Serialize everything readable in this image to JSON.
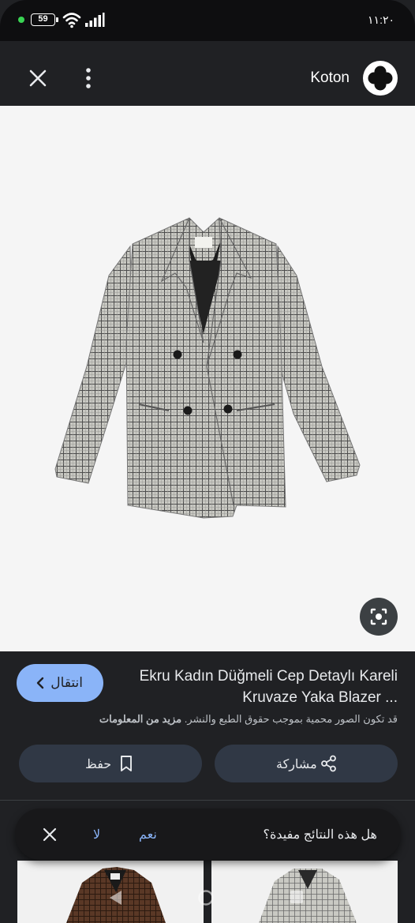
{
  "status_bar": {
    "battery": "59",
    "time": "١١:٢٠",
    "icons": [
      "notification-dot-icon",
      "battery-icon",
      "wifi-icon",
      "signal-icon"
    ]
  },
  "top_bar": {
    "close_icon": "close-icon",
    "more_icon": "more-vert-icon",
    "brand": "Koton",
    "logo_icon": "koton-flower-logo"
  },
  "image": {
    "subject": "jacket-photo",
    "lens_icon": "lens-search-icon"
  },
  "result": {
    "visit_label": "انتقال",
    "title": "Ekru Kadın Düğmeli Cep Detaylı Kareli Kruvaze Yaka Blazer ...",
    "copyright_text": "قد تكون الصور محمية بموجب حقوق الطبع والنشر.",
    "more_info": "مزيد من المعلومات",
    "share_label": "مشاركة",
    "save_label": "حفظ"
  },
  "feedback": {
    "question": "هل هذه النتائج مفيدة؟",
    "yes": "نعم",
    "no": "لا"
  },
  "colors": {
    "background": "#202124",
    "accent": "#8ab4f8",
    "pill": "#303845",
    "image_bg": "#f5f5f5"
  }
}
